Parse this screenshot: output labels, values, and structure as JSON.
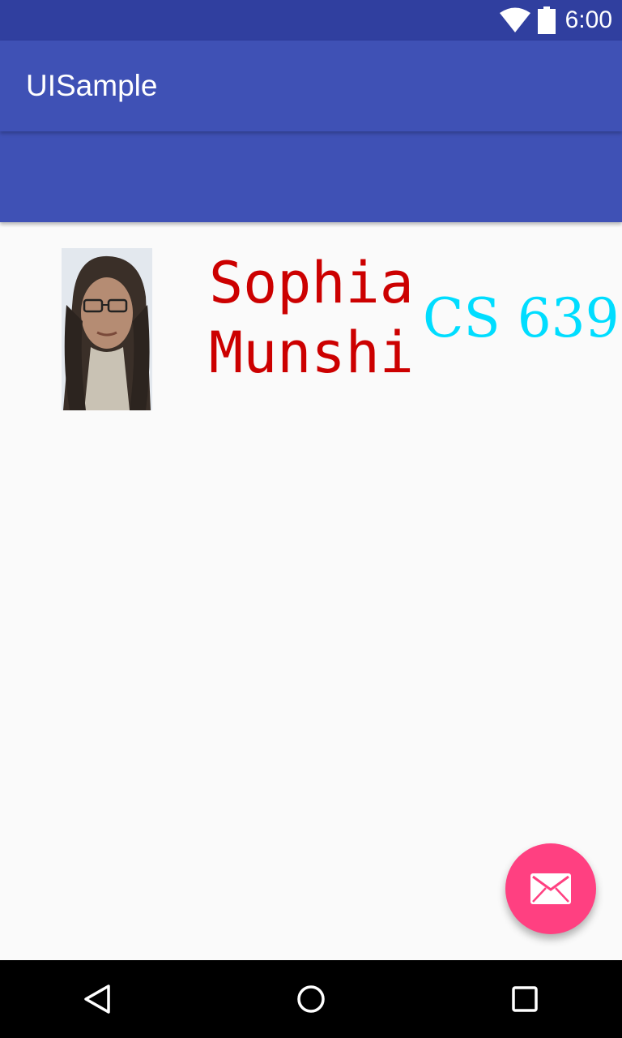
{
  "status_bar": {
    "time": "6:00",
    "icons": [
      "wifi-icon",
      "battery-icon"
    ]
  },
  "toolbar": {
    "title": "UISample"
  },
  "profile": {
    "photo": "profile-photo",
    "name": "Sophia Munshi",
    "course": "CS 639"
  },
  "fab": {
    "icon": "mail-icon"
  },
  "nav_bar": {
    "buttons": [
      "back-icon",
      "home-icon",
      "recents-icon"
    ]
  },
  "colors": {
    "status_bar": "#303f9f",
    "primary": "#3f51b5",
    "background": "#fafafa",
    "name_text": "#cc0000",
    "course_text": "#00ddff",
    "fab": "#ff4081"
  }
}
